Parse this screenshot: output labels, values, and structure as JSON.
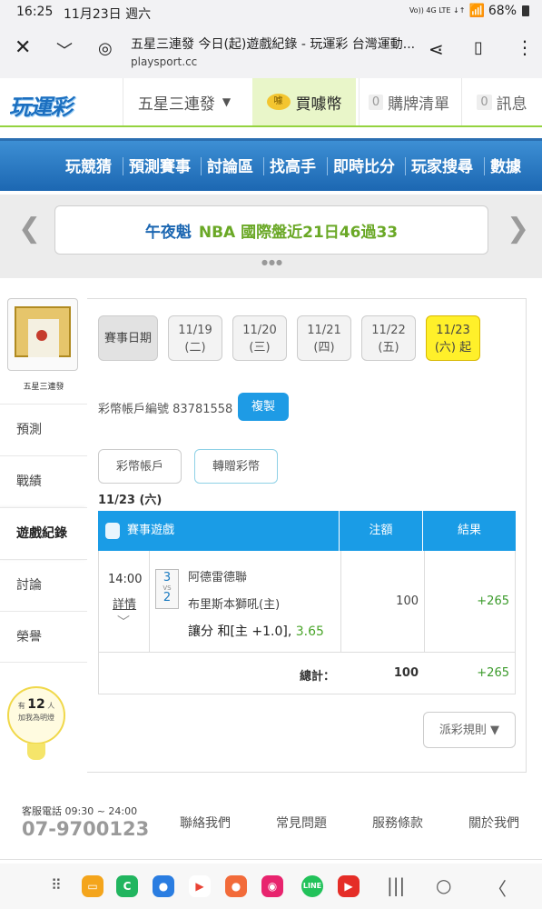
{
  "status_bar": {
    "time": "16:25",
    "date": "11月23日 週六",
    "network": "Vo)) 4G LTE ↓↑",
    "battery": "68%"
  },
  "browser": {
    "title": "五星三連發 今日(起)遊戲紀錄 - 玩運彩 台灣運動...",
    "url": "playsport.cc"
  },
  "header": {
    "logo": "玩運彩",
    "dropdown": "五星三連發",
    "buy_label": "買噱幣",
    "coin_text": "噱",
    "cart_count": "0",
    "cart_label": "購牌清單",
    "msg_count": "0",
    "msg_label": "訊息"
  },
  "main_nav": [
    "玩競猜",
    "預測賽事",
    "討論區",
    "找高手",
    "即時比分",
    "玩家搜尋",
    "數據"
  ],
  "banner": {
    "part1": "午夜魁",
    "part2": "NBA 國際盤近21日46過33"
  },
  "sidebar": {
    "user_name": "五星三連發",
    "items": [
      "預測",
      "戰績",
      "遊戲紀錄",
      "討論",
      "榮譽"
    ],
    "helpful": {
      "prefix": "有",
      "count": "12",
      "unit": "人",
      "suffix": "加我為明燈"
    }
  },
  "dates": {
    "label": "賽事日期",
    "items": [
      {
        "date": "11/19",
        "day": "(二)"
      },
      {
        "date": "11/20",
        "day": "(三)"
      },
      {
        "date": "11/21",
        "day": "(四)"
      },
      {
        "date": "11/22",
        "day": "(五)"
      },
      {
        "date": "11/23",
        "day": "(六) 起"
      }
    ]
  },
  "account": {
    "label": "彩幣帳戶編號 83781558",
    "copy": "複製"
  },
  "tabs": [
    "彩幣帳戶",
    "轉贈彩幣"
  ],
  "current_date": "11/23 (六)",
  "table": {
    "headers": [
      "賽事遊戲",
      "注額",
      "結果"
    ],
    "rows": [
      {
        "time": "14:00",
        "detail": "詳情",
        "score_away": "3",
        "score_vs": "VS",
        "score_home": "2",
        "team_away": "阿德雷德聯",
        "team_home": "布里斯本獅吼(主)",
        "bet": "讓分 和[主 +1.0]",
        "odds": "3.65",
        "amount": "100",
        "result": "+265"
      }
    ],
    "total_label": "總計：",
    "total_amount": "100",
    "total_result": "+265"
  },
  "rules_button": "派彩規則 ▼",
  "footer": {
    "service": "客服電話 09:30 ~ 24:00",
    "phone": "07-9700123",
    "links": [
      "聯絡我們",
      "常見問題",
      "服務條款",
      "關於我們"
    ]
  },
  "colors": {
    "brand_blue": "#1c67b2",
    "accent_green": "#94d33f",
    "table_header": "#1a9ce6",
    "active_date": "#fff02a"
  }
}
